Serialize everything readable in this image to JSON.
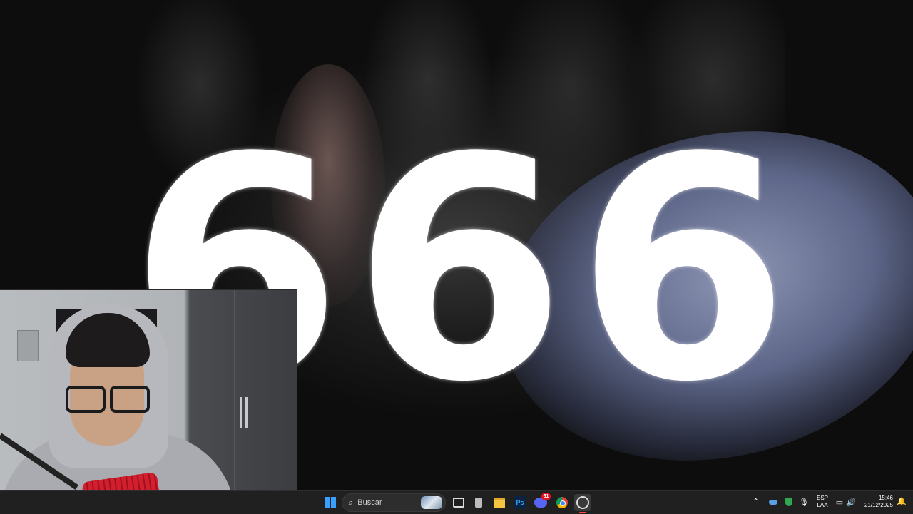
{
  "video": {
    "overlay_text": [
      "6",
      "6",
      "6"
    ]
  },
  "taskbar": {
    "search_placeholder": "Buscar",
    "discord_badge": "61",
    "tray": {
      "language_top": "ESP",
      "language_bottom": "LAA",
      "time": "15:46",
      "date": "21/12/2025"
    }
  },
  "icons": {
    "start": "windows-logo",
    "search": "magnifier",
    "task_view": "task-view",
    "terminal": "terminal",
    "file_explorer": "folder",
    "photoshop": "photoshop",
    "discord": "discord",
    "chrome": "chrome",
    "obs": "obs-recorder"
  },
  "colors": {
    "taskbar_bg": "#202020",
    "accent_blue": "#3aa0ff",
    "recording_red": "#ff4b4b"
  }
}
